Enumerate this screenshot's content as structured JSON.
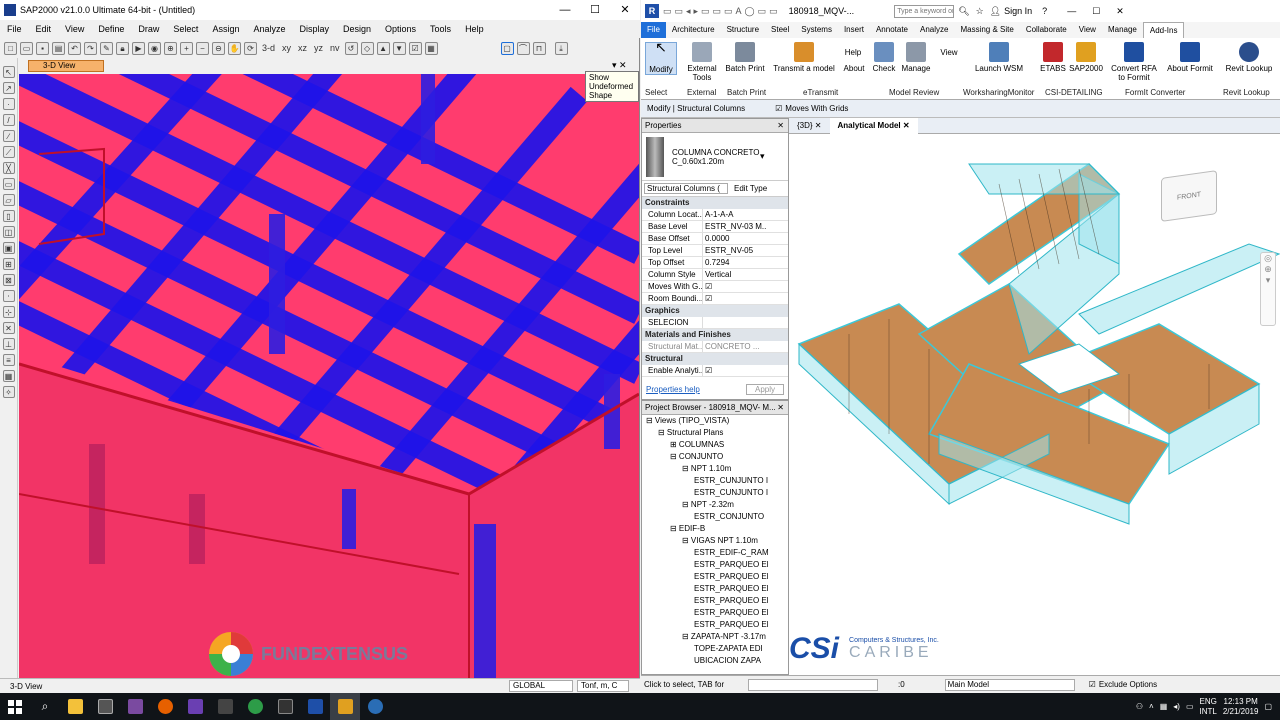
{
  "sap": {
    "title": "SAP2000 v21.0.0 Ultimate 64-bit - (Untitled)",
    "menu": [
      "File",
      "Edit",
      "View",
      "Define",
      "Draw",
      "Select",
      "Assign",
      "Analyze",
      "Display",
      "Design",
      "Options",
      "Tools",
      "Help"
    ],
    "toolbar_text": [
      "3-d",
      "xy",
      "xz",
      "yz",
      "nv"
    ],
    "view_tab": "3-D View",
    "tooltip": "Show Undeformed Shape",
    "status_left": "3-D View",
    "coord_system": "GLOBAL",
    "units": "Tonf, m, C",
    "logo_text": "FUNDEXTENSUS"
  },
  "revit": {
    "title_file": "180918_MQV-...",
    "search_placeholder": "Type a keyword or phrase",
    "sign_in": "Sign In",
    "tabs": [
      "File",
      "Architecture",
      "Structure",
      "Steel",
      "Systems",
      "Insert",
      "Annotate",
      "Analyze",
      "Massing & Site",
      "Collaborate",
      "View",
      "Manage",
      "Add-Ins"
    ],
    "active_tab": "Add-Ins",
    "ribbon_buttons": [
      {
        "label": "Modify"
      },
      {
        "label": "External Tools"
      },
      {
        "label": "Batch Print"
      },
      {
        "label": "Transmit a model"
      },
      {
        "label": "Help"
      },
      {
        "label": "About"
      },
      {
        "label": "Check"
      },
      {
        "label": "Manage"
      },
      {
        "label": "View"
      },
      {
        "label": "Launch WSM"
      },
      {
        "label": "ETABS"
      },
      {
        "label": "SAP2000"
      },
      {
        "label": "Convert RFA to Formit"
      },
      {
        "label": "About Formit"
      },
      {
        "label": "Revit Lookup"
      }
    ],
    "ribbon_panels": [
      "Select",
      "External",
      "Batch Print",
      "eTransmit",
      "Model Review",
      "WorksharingMonitor",
      "CSI-DETAILING",
      "FormIt Converter",
      "Revit Lookup"
    ],
    "context_label": "Modify | Structural Columns",
    "moves_with_grids": "Moves With Grids",
    "properties": {
      "header": "Properties",
      "type_name": "COLUMNA CONCRETO C_0.60x1.20m",
      "filter": "Structural Columns (",
      "edit_type": "Edit Type",
      "sections": {
        "constraints": "Constraints",
        "graphics": "Graphics",
        "materials": "Materials and Finishes",
        "structural": "Structural"
      },
      "rows": [
        {
          "k": "Column Locat...",
          "v": "A-1-A-A"
        },
        {
          "k": "Base Level",
          "v": "ESTR_NV-03 M..."
        },
        {
          "k": "Base Offset",
          "v": "0.0000"
        },
        {
          "k": "Top Level",
          "v": "ESTR_NV-05"
        },
        {
          "k": "Top Offset",
          "v": "0.7294"
        },
        {
          "k": "Column Style",
          "v": "Vertical"
        },
        {
          "k": "Moves With G...",
          "v": "☑"
        },
        {
          "k": "Room Boundi...",
          "v": "☑"
        }
      ],
      "graphics_row": {
        "k": "SELECION",
        "v": ""
      },
      "material_row": {
        "k": "Structural Mat...",
        "v": "CONCRETO ..."
      },
      "structural_row": {
        "k": "Enable Analyti...",
        "v": "☑"
      },
      "help_link": "Properties help",
      "apply": "Apply"
    },
    "browser": {
      "header": "Project Browser - 180918_MQV- M...",
      "items": [
        {
          "indent": 0,
          "text": "⊟ Views (TIPO_VISTA)"
        },
        {
          "indent": 1,
          "text": "⊟ Structural Plans"
        },
        {
          "indent": 2,
          "text": "⊞ COLUMNAS"
        },
        {
          "indent": 2,
          "text": "⊟ CONJUNTO"
        },
        {
          "indent": 3,
          "text": "⊟ NPT 1.10m"
        },
        {
          "indent": 4,
          "text": "ESTR_CUNJUNTO I"
        },
        {
          "indent": 4,
          "text": "ESTR_CUNJUNTO I"
        },
        {
          "indent": 3,
          "text": "⊟ NPT -2.32m"
        },
        {
          "indent": 4,
          "text": "ESTR_CONJUNTO"
        },
        {
          "indent": 2,
          "text": "⊟ EDIF-B"
        },
        {
          "indent": 3,
          "text": "⊟ VIGAS NPT 1.10m"
        },
        {
          "indent": 4,
          "text": "ESTR_EDIF-C_RAM"
        },
        {
          "indent": 4,
          "text": "ESTR_PARQUEO El"
        },
        {
          "indent": 4,
          "text": "ESTR_PARQUEO El"
        },
        {
          "indent": 4,
          "text": "ESTR_PARQUEO El"
        },
        {
          "indent": 4,
          "text": "ESTR_PARQUEO El"
        },
        {
          "indent": 4,
          "text": "ESTR_PARQUEO El"
        },
        {
          "indent": 4,
          "text": "ESTR_PARQUEO El"
        },
        {
          "indent": 3,
          "text": "⊟ ZAPATA-NPT -3.17m"
        },
        {
          "indent": 4,
          "text": "TOPE-ZAPATA EDI"
        },
        {
          "indent": 4,
          "text": "UBICACION ZAPA"
        }
      ]
    },
    "view_tabs": [
      "{3D}",
      "Analytical Model"
    ],
    "viewcube_label": "FRONT",
    "status_text": "Click to select, TAB for",
    "status_model": "Main Model",
    "exclude_options": "Exclude Options",
    "watermark_company": "Computers & Structures, Inc.",
    "watermark_csi": "CSi",
    "watermark_caribe": "CARIBE"
  },
  "taskbar": {
    "lang": "ENG",
    "region": "INTL",
    "time": "12:13 PM",
    "date": "2/21/2019"
  }
}
